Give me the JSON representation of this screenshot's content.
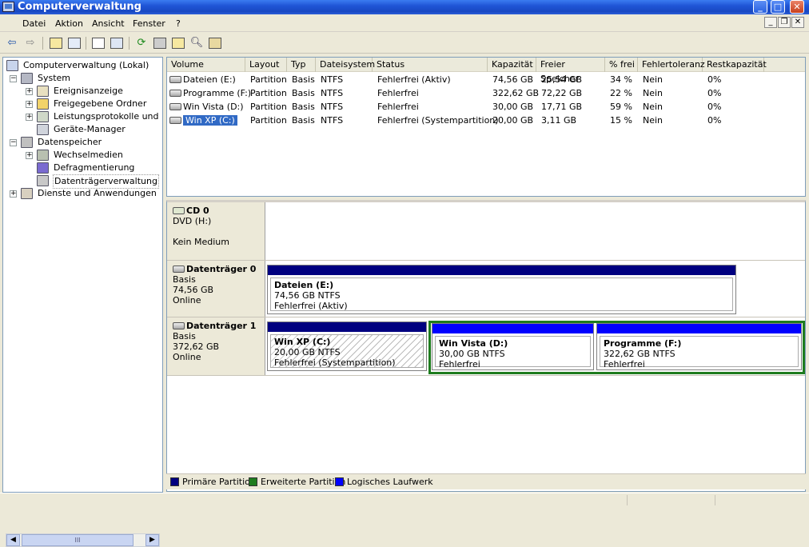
{
  "window": {
    "title": "Computerverwaltung"
  },
  "menu": [
    "Datei",
    "Aktion",
    "Ansicht",
    "Fenster",
    "?"
  ],
  "tree": {
    "root": "Computerverwaltung (Lokal)",
    "system": "System",
    "system_children": [
      "Ereignisanzeige",
      "Freigegebene Ordner",
      "Leistungsprotokolle und Warnungen",
      "Geräte-Manager"
    ],
    "storage": "Datenspeicher",
    "storage_children": [
      "Wechselmedien",
      "Defragmentierung",
      "Datenträgerverwaltung"
    ],
    "services": "Dienste und Anwendungen",
    "scroll_thumb": "III"
  },
  "volume_table": {
    "columns": [
      "Volume",
      "Layout",
      "Typ",
      "Dateisystem",
      "Status",
      "Kapazität",
      "Freier Speicher",
      "% frei",
      "Fehlertoleranz",
      "Restkapazität"
    ],
    "rows": [
      [
        "Dateien (E:)",
        "Partition",
        "Basis",
        "NTFS",
        "Fehlerfrei (Aktiv)",
        "74,56 GB",
        "25,54 GB",
        "34 %",
        "Nein",
        "0%"
      ],
      [
        "Programme (F:)",
        "Partition",
        "Basis",
        "NTFS",
        "Fehlerfrei",
        "322,62 GB",
        "72,22 GB",
        "22 %",
        "Nein",
        "0%"
      ],
      [
        "Win Vista (D:)",
        "Partition",
        "Basis",
        "NTFS",
        "Fehlerfrei",
        "30,00 GB",
        "17,71 GB",
        "59 %",
        "Nein",
        "0%"
      ],
      [
        "Win XP (C:)",
        "Partition",
        "Basis",
        "NTFS",
        "Fehlerfrei (Systempartition)",
        "20,00 GB",
        "3,11 GB",
        "15 %",
        "Nein",
        "0%"
      ]
    ]
  },
  "disks": {
    "cd0": {
      "name": "CD 0",
      "type": "DVD (H:)",
      "media": "Kein Medium"
    },
    "disk0": {
      "name": "Datenträger 0",
      "kind": "Basis",
      "size": "74,56 GB",
      "state": "Online",
      "partition": {
        "title": "Dateien  (E:)",
        "size": "74,56 GB NTFS",
        "status": "Fehlerfrei (Aktiv)"
      }
    },
    "disk1": {
      "name": "Datenträger 1",
      "kind": "Basis",
      "size": "372,62 GB",
      "state": "Online",
      "partitions": [
        {
          "title": "Win XP  (C:)",
          "size": "20,00 GB NTFS",
          "status": "Fehlerfrei (Systempartition)"
        },
        {
          "title": "Win Vista  (D:)",
          "size": "30,00 GB NTFS",
          "status": "Fehlerfrei"
        },
        {
          "title": "Programme  (F:)",
          "size": "322,62 GB NTFS",
          "status": "Fehlerfrei"
        }
      ]
    }
  },
  "legend": {
    "primary": "Primäre Partition",
    "extended": "Erweiterte Partition",
    "logical": "Logisches Laufwerk"
  },
  "colors": {
    "primary": "#000080",
    "extended": "#1e7c1e",
    "logical": "#0000ff",
    "selection": "#316ac5"
  }
}
